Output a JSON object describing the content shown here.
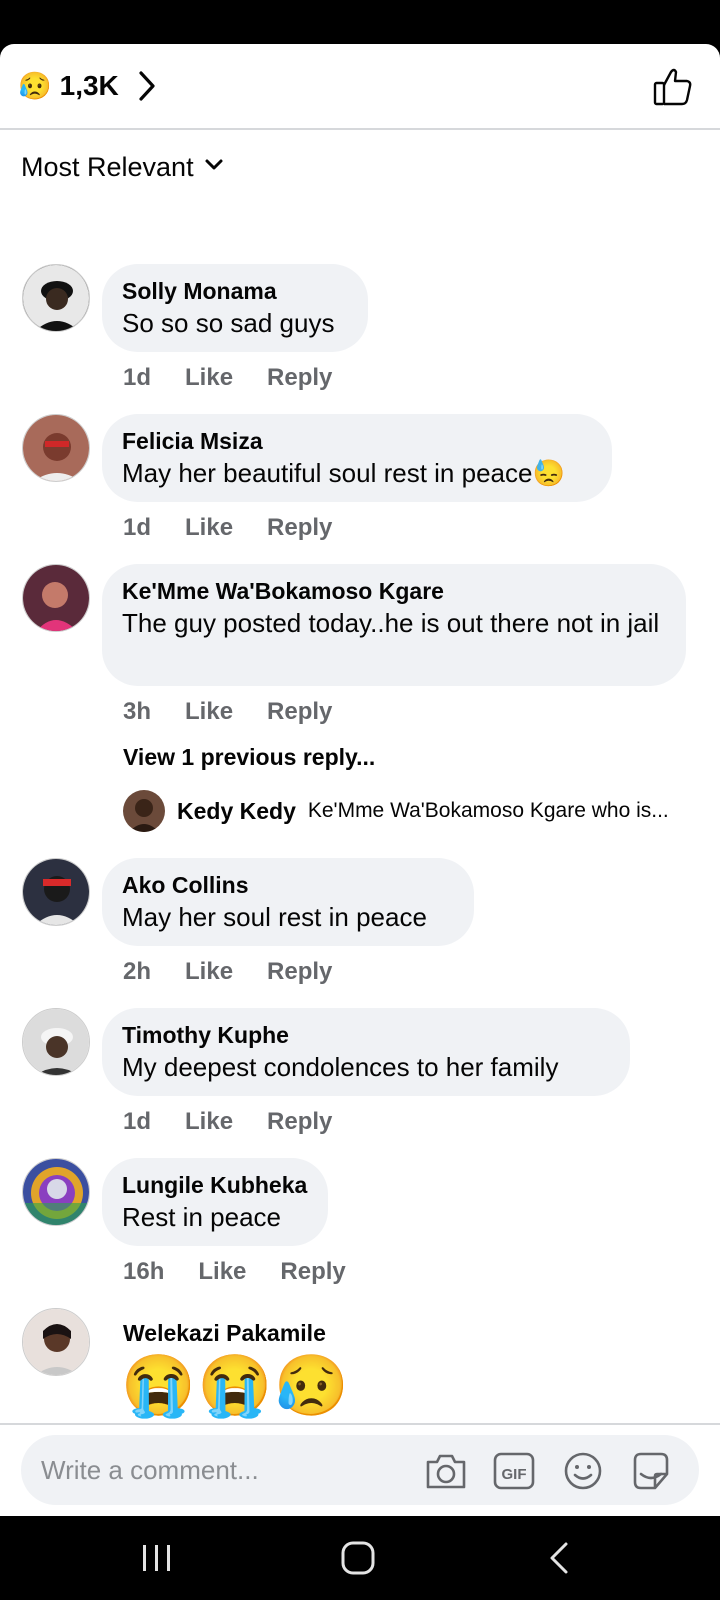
{
  "reactions": {
    "emoji": "😥",
    "count": "1,3K"
  },
  "sort": {
    "label": "Most Relevant"
  },
  "comments": [
    {
      "author": "Solly Monama",
      "text": "So so so sad guys",
      "time": "1d",
      "like": "Like",
      "reply": "Reply"
    },
    {
      "author": "Felicia Msiza",
      "text": "May her beautiful soul rest in peace😓",
      "time": "1d",
      "like": "Like",
      "reply": "Reply"
    },
    {
      "author": "Ke'Mme Wa'Bokamoso Kgare",
      "text": "The guy posted today..he is out there not in jail",
      "time": "3h",
      "like": "Like",
      "reply": "Reply",
      "view_replies": "View 1 previous reply...",
      "reply_preview": {
        "author": "Kedy Kedy",
        "text": "Ke'Mme Wa'Bokamoso Kgare who is..."
      }
    },
    {
      "author": "Ako Collins",
      "text": "May her soul rest in peace",
      "time": "2h",
      "like": "Like",
      "reply": "Reply"
    },
    {
      "author": "Timothy Kuphe",
      "text": "My deepest condolences to her family",
      "time": "1d",
      "like": "Like",
      "reply": "Reply"
    },
    {
      "author": "Lungile Kubheka",
      "text": "Rest in peace",
      "time": "16h",
      "like": "Like",
      "reply": "Reply"
    },
    {
      "author": "Welekazi Pakamile",
      "text": "😭😭😥"
    }
  ],
  "composer": {
    "placeholder": "Write a comment..."
  },
  "icons": [
    "chevron-right-icon",
    "thumbs-up-icon",
    "chevron-down-icon",
    "camera-icon",
    "gif-icon",
    "emoji-icon",
    "sticker-icon",
    "recents-icon",
    "home-icon",
    "back-icon"
  ],
  "colors": {
    "bubble": "#f0f2f5",
    "meta": "#65676b",
    "text": "#050505"
  }
}
